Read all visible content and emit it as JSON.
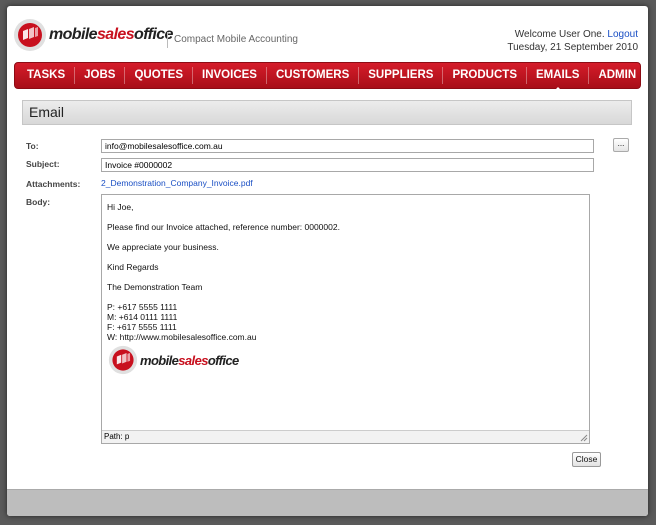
{
  "brand": {
    "name_part1": "mobile",
    "name_part2": "sales",
    "name_part3": "office",
    "tagline": "Compact Mobile Accounting",
    "accent": "#c8101e"
  },
  "user": {
    "welcome": "Welcome User One.",
    "logout": "Logout",
    "date": "Tuesday, 21 September 2010"
  },
  "nav": {
    "items": [
      "TASKS",
      "JOBS",
      "QUOTES",
      "INVOICES",
      "CUSTOMERS",
      "SUPPLIERS",
      "PRODUCTS",
      "EMAILS",
      "ADMIN"
    ],
    "active": "EMAILS"
  },
  "section": {
    "title": "Email"
  },
  "form": {
    "to_label": "To:",
    "to_value": "info@mobilesalesoffice.com.au",
    "more_label": "...",
    "subject_label": "Subject:",
    "subject_value": "Invoice #0000002",
    "attachments_label": "Attachments:",
    "attachment": "2_Demonstration_Company_Invoice.pdf",
    "body_label": "Body:"
  },
  "body": {
    "greeting": "Hi Joe,",
    "line1": "Please find our Invoice attached, reference number: 0000002.",
    "line2": "We appreciate your business.",
    "closing": "Kind Regards",
    "team": "The Demonstration Team",
    "phone": "P: +617 5555 1111",
    "mobile": "M: +614 0111 1111",
    "fax": "F: +617 5555 1111",
    "web": "W: http://www.mobilesalesoffice.com.au",
    "status_path": "Path: p"
  },
  "actions": {
    "close": "Close"
  }
}
